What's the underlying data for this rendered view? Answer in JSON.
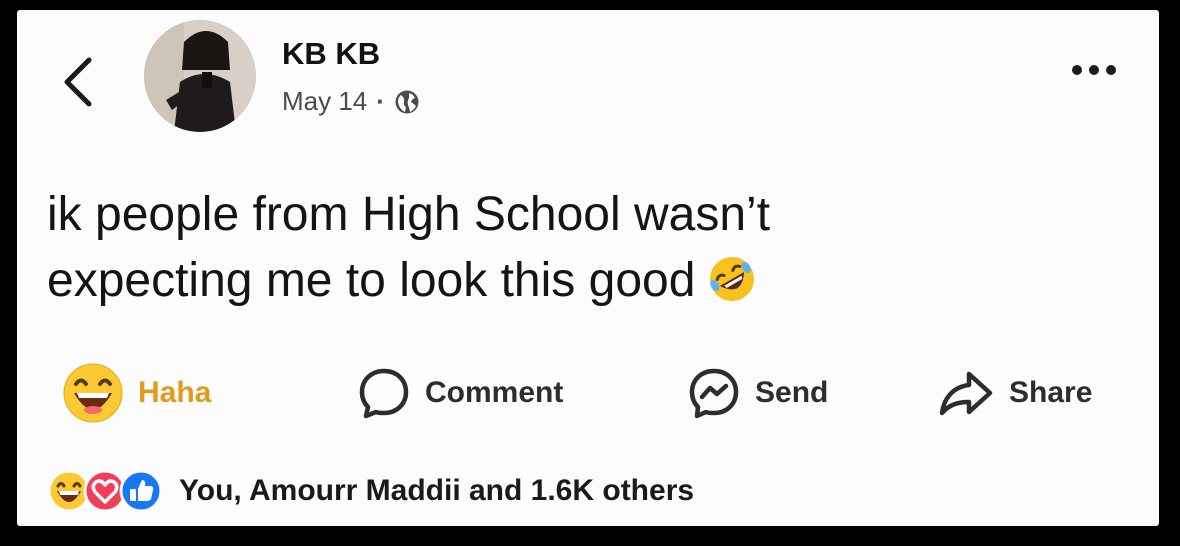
{
  "post": {
    "author": "KB KB",
    "date": "May 14",
    "separator": "·",
    "privacy_icon": "globe-icon",
    "text_line1": "ik people from High School wasn’t",
    "text_line2": "expecting me to look this good",
    "text_emoji": "rolling-on-floor-laughing-emoji"
  },
  "actions": {
    "haha": "Haha",
    "comment": "Comment",
    "send": "Send",
    "share": "Share"
  },
  "reactions": {
    "icons": [
      "haha-icon",
      "love-icon",
      "like-icon"
    ],
    "summary": "You, Amourr Maddii and 1.6K others"
  },
  "colors": {
    "haha": "#e29a1a",
    "love": "#f33e58",
    "like": "#1877f2",
    "card": "#fcfcfc"
  }
}
